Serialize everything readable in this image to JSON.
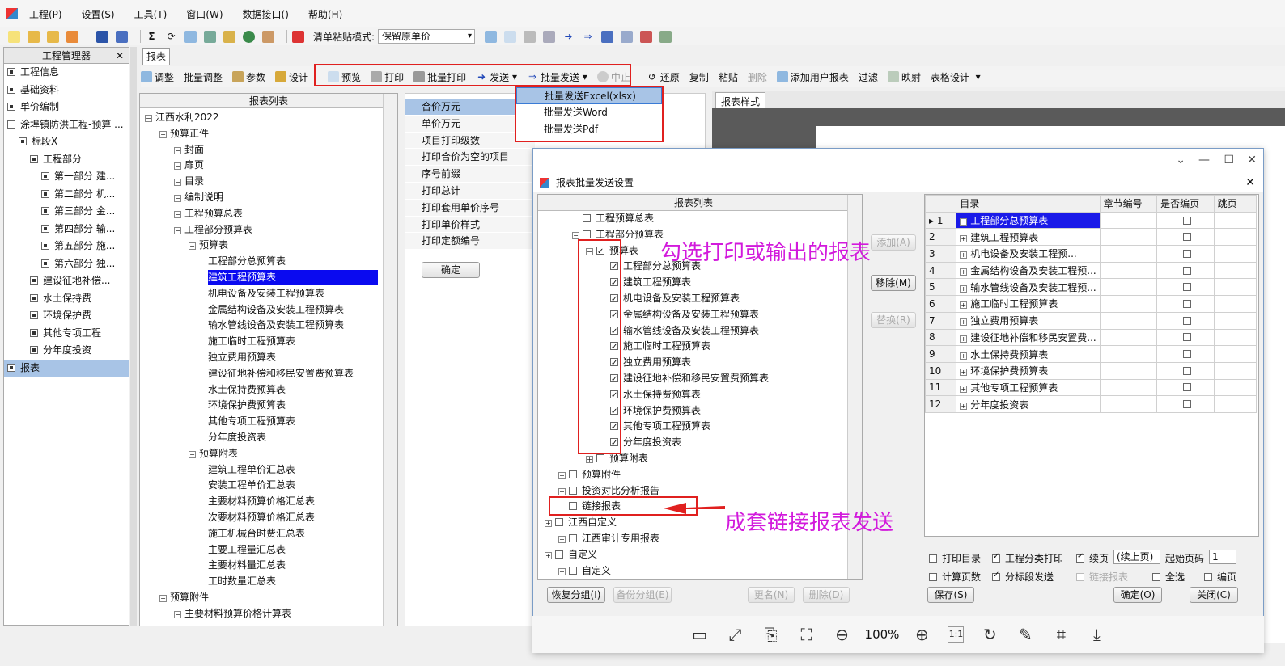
{
  "menu": [
    "工程(P)",
    "设置(S)",
    "工具(T)",
    "窗口(W)",
    "数据接口()",
    "帮助(H)"
  ],
  "toolbar1": {
    "paste_mode_label": "清单粘贴模式:",
    "paste_mode_value": "保留原单价"
  },
  "left_panel": {
    "title": "工程管理器",
    "close": "✕",
    "items": [
      {
        "label": "工程信息",
        "indent": 0
      },
      {
        "label": "基础资料",
        "indent": 0
      },
      {
        "label": "单价编制",
        "indent": 0
      },
      {
        "label": "涂埠镇防洪工程-预算 ...",
        "indent": 0
      },
      {
        "label": "标段X",
        "indent": 1
      },
      {
        "label": "工程部分",
        "indent": 2
      },
      {
        "label": "第一部分 建...",
        "indent": 3
      },
      {
        "label": "第二部分 机...",
        "indent": 3
      },
      {
        "label": "第三部分 金...",
        "indent": 3
      },
      {
        "label": "第四部分 输...",
        "indent": 3
      },
      {
        "label": "第五部分 施...",
        "indent": 3
      },
      {
        "label": "第六部分 独...",
        "indent": 3
      },
      {
        "label": "建设征地补偿...",
        "indent": 2
      },
      {
        "label": "水土保持费",
        "indent": 2
      },
      {
        "label": "环境保护费",
        "indent": 2
      },
      {
        "label": "其他专项工程",
        "indent": 2
      },
      {
        "label": "分年度投资",
        "indent": 2
      },
      {
        "label": "报表",
        "indent": 0
      }
    ]
  },
  "tab": "报表",
  "toolbar2": [
    "调整",
    "批量调整",
    "参数",
    "设计",
    "预览",
    "打印",
    "批量打印",
    "发送",
    "批量发送",
    "中止",
    "还原",
    "复制",
    "粘贴",
    "删除",
    "添加用户报表",
    "过滤",
    "映射",
    "表格设计"
  ],
  "report_list": {
    "header": "报表列表",
    "rows": [
      {
        "label": "江西水利2022",
        "lvl": 0
      },
      {
        "label": "预算正件",
        "lvl": 1
      },
      {
        "label": "封面",
        "lvl": 2
      },
      {
        "label": "扉页",
        "lvl": 2
      },
      {
        "label": "目录",
        "lvl": 2
      },
      {
        "label": "编制说明",
        "lvl": 2
      },
      {
        "label": "工程预算总表",
        "lvl": 2
      },
      {
        "label": "工程部分预算表",
        "lvl": 2
      },
      {
        "label": "预算表",
        "lvl": 3
      },
      {
        "label": "工程部分总预算表",
        "lvl": 4
      },
      {
        "label": "建筑工程预算表",
        "lvl": 4
      },
      {
        "label": "机电设备及安装工程预算表",
        "lvl": 4
      },
      {
        "label": "金属结构设备及安装工程预算表",
        "lvl": 4
      },
      {
        "label": "输水管线设备及安装工程预算表",
        "lvl": 4
      },
      {
        "label": "施工临时工程预算表",
        "lvl": 4
      },
      {
        "label": "独立费用预算表",
        "lvl": 4
      },
      {
        "label": "建设征地补偿和移民安置费预算表",
        "lvl": 4
      },
      {
        "label": "水土保持费预算表",
        "lvl": 4
      },
      {
        "label": "环境保护费预算表",
        "lvl": 4
      },
      {
        "label": "其他专项工程预算表",
        "lvl": 4
      },
      {
        "label": "分年度投资表",
        "lvl": 4
      },
      {
        "label": "预算附表",
        "lvl": 3
      },
      {
        "label": "建筑工程单价汇总表",
        "lvl": 4
      },
      {
        "label": "安装工程单价汇总表",
        "lvl": 4
      },
      {
        "label": "主要材料预算价格汇总表",
        "lvl": 4
      },
      {
        "label": "次要材料预算价格汇总表",
        "lvl": 4
      },
      {
        "label": "施工机械台时费汇总表",
        "lvl": 4
      },
      {
        "label": "主要工程量汇总表",
        "lvl": 4
      },
      {
        "label": "主要材料量汇总表",
        "lvl": 4
      },
      {
        "label": "工时数量汇总表",
        "lvl": 4
      },
      {
        "label": "预算附件",
        "lvl": 1
      },
      {
        "label": "主要材料预算价格计算表",
        "lvl": 2
      }
    ]
  },
  "props": [
    "合价万元",
    "单价万元",
    "项目打印级数",
    "打印合价为空的项目",
    "序号前缀",
    "打印总计",
    "打印套用单价序号",
    "打印单价样式",
    "打印定额编号"
  ],
  "props_confirm": "确定",
  "report_style": "报表样式",
  "dropdown": [
    "批量发送Excel(xlsx)",
    "批量发送Word",
    "批量发送Pdf"
  ],
  "dialog": {
    "title": "报表批量发送设置",
    "tree_header": "报表列表",
    "tree": [
      {
        "label": "工程预算总表",
        "lvl": 2,
        "chk": false
      },
      {
        "label": "工程部分预算表",
        "lvl": 2,
        "chk": false,
        "exp": true
      },
      {
        "label": "预算表",
        "lvl": 3,
        "chk": true,
        "exp": true
      },
      {
        "label": "工程部分总预算表",
        "lvl": 4,
        "chk": true
      },
      {
        "label": "建筑工程预算表",
        "lvl": 4,
        "chk": true
      },
      {
        "label": "机电设备及安装工程预算表",
        "lvl": 4,
        "chk": true
      },
      {
        "label": "金属结构设备及安装工程预算表",
        "lvl": 4,
        "chk": true
      },
      {
        "label": "输水管线设备及安装工程预算表",
        "lvl": 4,
        "chk": true
      },
      {
        "label": "施工临时工程预算表",
        "lvl": 4,
        "chk": true
      },
      {
        "label": "独立费用预算表",
        "lvl": 4,
        "chk": true
      },
      {
        "label": "建设征地补偿和移民安置费预算表",
        "lvl": 4,
        "chk": true
      },
      {
        "label": "水土保持费预算表",
        "lvl": 4,
        "chk": true
      },
      {
        "label": "环境保护费预算表",
        "lvl": 4,
        "chk": true
      },
      {
        "label": "其他专项工程预算表",
        "lvl": 4,
        "chk": true
      },
      {
        "label": "分年度投资表",
        "lvl": 4,
        "chk": true
      },
      {
        "label": "预算附表",
        "lvl": 3,
        "chk": false,
        "exp": true
      },
      {
        "label": "预算附件",
        "lvl": 1,
        "chk": false,
        "exp": true
      },
      {
        "label": "投资对比分析报告",
        "lvl": 1,
        "chk": false,
        "exp": true
      },
      {
        "label": "链接报表",
        "lvl": 1,
        "chk": false
      },
      {
        "label": "江西自定义",
        "lvl": 0,
        "chk": false,
        "exp": true
      },
      {
        "label": "江西审计专用报表",
        "lvl": 1,
        "chk": false,
        "exp": true
      },
      {
        "label": "自定义",
        "lvl": 0,
        "chk": false,
        "exp": true
      },
      {
        "label": "自定义",
        "lvl": 1,
        "chk": false,
        "exp": true
      }
    ],
    "mid_buttons": [
      "添加(A)",
      "移除(M)",
      "替换(R)"
    ],
    "grid_headers": [
      "目录",
      "章节编号",
      "是否编页",
      "跳页"
    ],
    "grid_rows": [
      "工程部分总预算表",
      "建筑工程预算表",
      "机电设备及安装工程预...",
      "金属结构设备及安装工程预...",
      "输水管线设备及安装工程预...",
      "施工临时工程预算表",
      "独立费用预算表",
      "建设征地补偿和移民安置费...",
      "水土保持费预算表",
      "环境保护费预算表",
      "其他专项工程预算表",
      "分年度投资表"
    ],
    "grid_first_marker": "▸ 1",
    "opts": {
      "print_dir": "打印目录",
      "classify": "工程分类打印",
      "continue": "续页",
      "cont_value": "(续上页)",
      "start_page": "起始页码",
      "start_value": "1",
      "calc_pages": "计算页数",
      "by_section": "分标段发送",
      "link_report": "链接报表",
      "select_all": "全选",
      "paging": "编页"
    },
    "bottom_buttons": {
      "restore": "恢复分组(I)",
      "backup": "备份分组(E)",
      "rename": "更名(N)",
      "delete": "删除(D)",
      "save": "保存(S)",
      "ok": "确定(O)",
      "close": "关闭(C)"
    }
  },
  "annotations": {
    "check": "勾选打印或输出的报表",
    "link": "成套链接报表发送"
  },
  "viewer": {
    "zoom": "100%"
  },
  "colors": {
    "highlight_red": "#e0201f",
    "annotation": "#d21adc",
    "selection_blue": "#1a1ae8"
  }
}
